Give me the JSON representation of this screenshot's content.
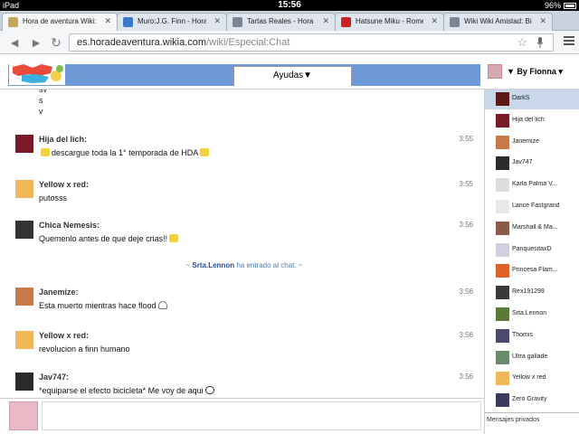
{
  "status_bar": {
    "device": "iPad",
    "time": "15:56",
    "battery": "96%"
  },
  "tabs": [
    {
      "label": "Hora de aventura Wiki: El",
      "color": "#c7a55a",
      "active": true
    },
    {
      "label": "Muro:J.G. Finn - Hora de",
      "color": "#3b78c7",
      "active": false
    },
    {
      "label": "Tartas Reales - Hora de a",
      "color": "#7a8694",
      "active": false
    },
    {
      "label": "Hatsune Miku - Romeo &",
      "color": "#cc2222",
      "active": false
    },
    {
      "label": "Wiki Wiki Amistad: Bienve",
      "color": "#7a8694",
      "active": false
    }
  ],
  "address": {
    "domain": "es.horadeaventura.wikia.com",
    "path": "/wiki/Especial:Chat"
  },
  "icons": {
    "back": "◄",
    "forward": "►",
    "reload": "↻",
    "close": "✕",
    "star": "☆",
    "menu": "menu-icon"
  },
  "header": {
    "room_tab": "Ayudas▼",
    "current_user": "▼ By Fionna ▾"
  },
  "messages": {
    "truncated_lines": [
      "sv",
      "s",
      "v"
    ],
    "items": [
      {
        "author": "Hija del lich:",
        "time": "3:55",
        "text_before": "",
        "text": "descargue toda la 1° temporada de HDA",
        "emote_before": true,
        "emote_after": true,
        "emote_kind": "",
        "avatar_color": "#7a1a28"
      },
      {
        "author": "Yellow x red:",
        "time": "3:55",
        "text_before": "",
        "text": "putosss",
        "emote_before": false,
        "emote_after": false,
        "emote_kind": "",
        "avatar_color": "#f0b85a"
      },
      {
        "author": "Chica Nemesis:",
        "time": "3:56",
        "text_before": "",
        "text": "Quemenlo antes de que deje crias!!",
        "emote_before": false,
        "emote_after": true,
        "emote_kind": "",
        "avatar_color": "#333333"
      },
      {
        "author": "Janemize:",
        "time": "3:56",
        "text_before": "",
        "text": "Esta muerto mientras hace flood",
        "emote_before": false,
        "emote_after": true,
        "emote_kind": "ghost",
        "avatar_color": "#c77a4a"
      },
      {
        "author": "Yellow x red:",
        "time": "3:56",
        "text_before": "",
        "text": "revolucion a finn humano",
        "emote_before": false,
        "emote_after": false,
        "emote_kind": "",
        "avatar_color": "#f0b85a"
      },
      {
        "author": "Jav747:",
        "time": "3:56",
        "text_before": "",
        "text": "*equiparse el efecto bicicleta* Me voy de aqui",
        "emote_before": false,
        "emote_after": true,
        "emote_kind": "face",
        "avatar_color": "#2a2a2a"
      }
    ],
    "join_event": {
      "prefix": "~ ",
      "user": "Srta.Lennon",
      "suffix": " ha entrado al chat. ~"
    }
  },
  "userlist": {
    "items": [
      {
        "name": "DarkS",
        "color": "#5a1a1a",
        "selected": true
      },
      {
        "name": "Hija del lich",
        "color": "#7a1a28",
        "selected": false
      },
      {
        "name": "Janemize",
        "color": "#c77a4a",
        "selected": false
      },
      {
        "name": "Jav747",
        "color": "#2a2a2a",
        "selected": false
      },
      {
        "name": "Karla Palma V...",
        "color": "#dddddd",
        "selected": false
      },
      {
        "name": "Lance Fastgrand",
        "color": "#e8e8e8",
        "selected": false
      },
      {
        "name": "Marshall & Ma...",
        "color": "#8a5a4a",
        "selected": false
      },
      {
        "name": "PanquesitaxD",
        "color": "#d0d0e0",
        "selected": false
      },
      {
        "name": "Princesa Flam...",
        "color": "#e0602a",
        "selected": false
      },
      {
        "name": "Rex191299",
        "color": "#3a3a3a",
        "selected": false
      },
      {
        "name": "Srta.Lennon",
        "color": "#5a7a3a",
        "selected": false
      },
      {
        "name": "Thomis",
        "color": "#4a4a6a",
        "selected": false
      },
      {
        "name": "Ultra gallade",
        "color": "#6a8a6a",
        "selected": false
      },
      {
        "name": "Yellow x red",
        "color": "#f0b85a",
        "selected": false
      },
      {
        "name": "Zero Gravity",
        "color": "#3a3a5a",
        "selected": false
      }
    ],
    "private_label": "Mensajes privados"
  }
}
